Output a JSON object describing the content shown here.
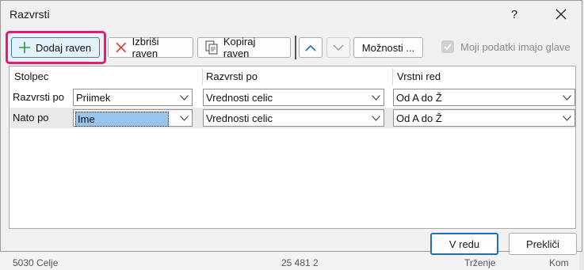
{
  "dialog": {
    "title": "Razvrsti",
    "help_label": "?"
  },
  "toolbar": {
    "add_level": "Dodaj raven",
    "delete_level": "Izbriši raven",
    "copy_level": "Kopiraj raven",
    "options": "Možnosti ...",
    "headers_checkbox_label": "Moji podatki imajo glave",
    "headers_checked": true
  },
  "grid": {
    "columns": [
      "Stolpec",
      "Razvrsti po",
      "Vrstni red"
    ],
    "rows": [
      {
        "label": "Razvrsti po",
        "column": "Priimek",
        "sort_on": "Vrednosti celic",
        "order": "Od A do Ž",
        "selected": false
      },
      {
        "label": "Nato po",
        "column": "Ime",
        "sort_on": "Vrednosti celic",
        "order": "Od A do Ž",
        "selected": true
      }
    ]
  },
  "footer": {
    "ok": "V redu",
    "cancel": "Prekliči"
  },
  "background": {
    "cells": [
      "5030 Celje",
      "25 481 2",
      "Trženje",
      "Kom"
    ]
  },
  "colors": {
    "highlight": "#e6197d",
    "accent": "#1f6fb8",
    "add_icon": "#2e9a3f",
    "delete_icon": "#d9342b"
  }
}
